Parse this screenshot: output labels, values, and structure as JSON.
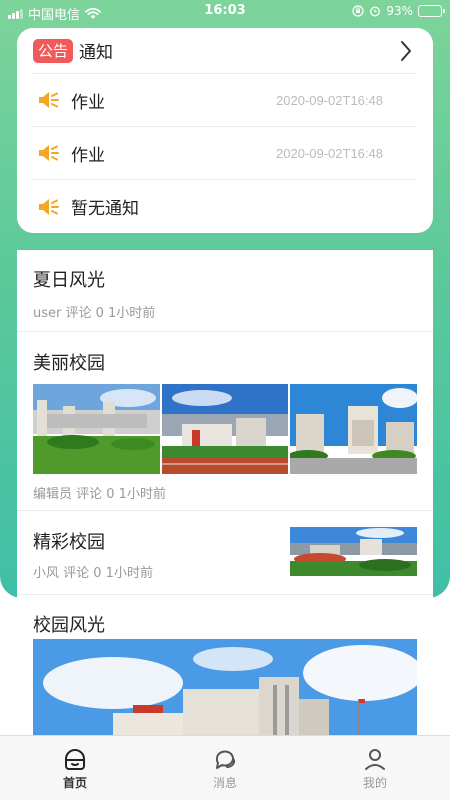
{
  "status_bar": {
    "carrier": "中国电信",
    "time": "16:03",
    "battery": "93%"
  },
  "notice": {
    "badge": "公告",
    "title": "通知",
    "items": [
      {
        "text": "作业",
        "time": "2020-09-02T16:48"
      },
      {
        "text": "作业",
        "time": "2020-09-02T16:48"
      },
      {
        "text": "暂无通知",
        "time": ""
      }
    ]
  },
  "feed": [
    {
      "title": "夏日风光",
      "meta": "user 评论 0 1小时前"
    },
    {
      "title": "美丽校园",
      "meta": "编辑员 评论 0 1小时前"
    },
    {
      "title": "精彩校园",
      "meta": "小风 评论 0 1小时前"
    }
  ],
  "section2": {
    "title": "校园风光"
  },
  "tabs": [
    {
      "label": "首页",
      "icon": "home-icon",
      "active": true
    },
    {
      "label": "消息",
      "icon": "message-icon",
      "active": false
    },
    {
      "label": "我的",
      "icon": "profile-icon",
      "active": false
    }
  ],
  "colors": {
    "accent_green": "#5cc99a",
    "badge_red": "#f05a5a",
    "speaker_orange": "#f5a623"
  }
}
